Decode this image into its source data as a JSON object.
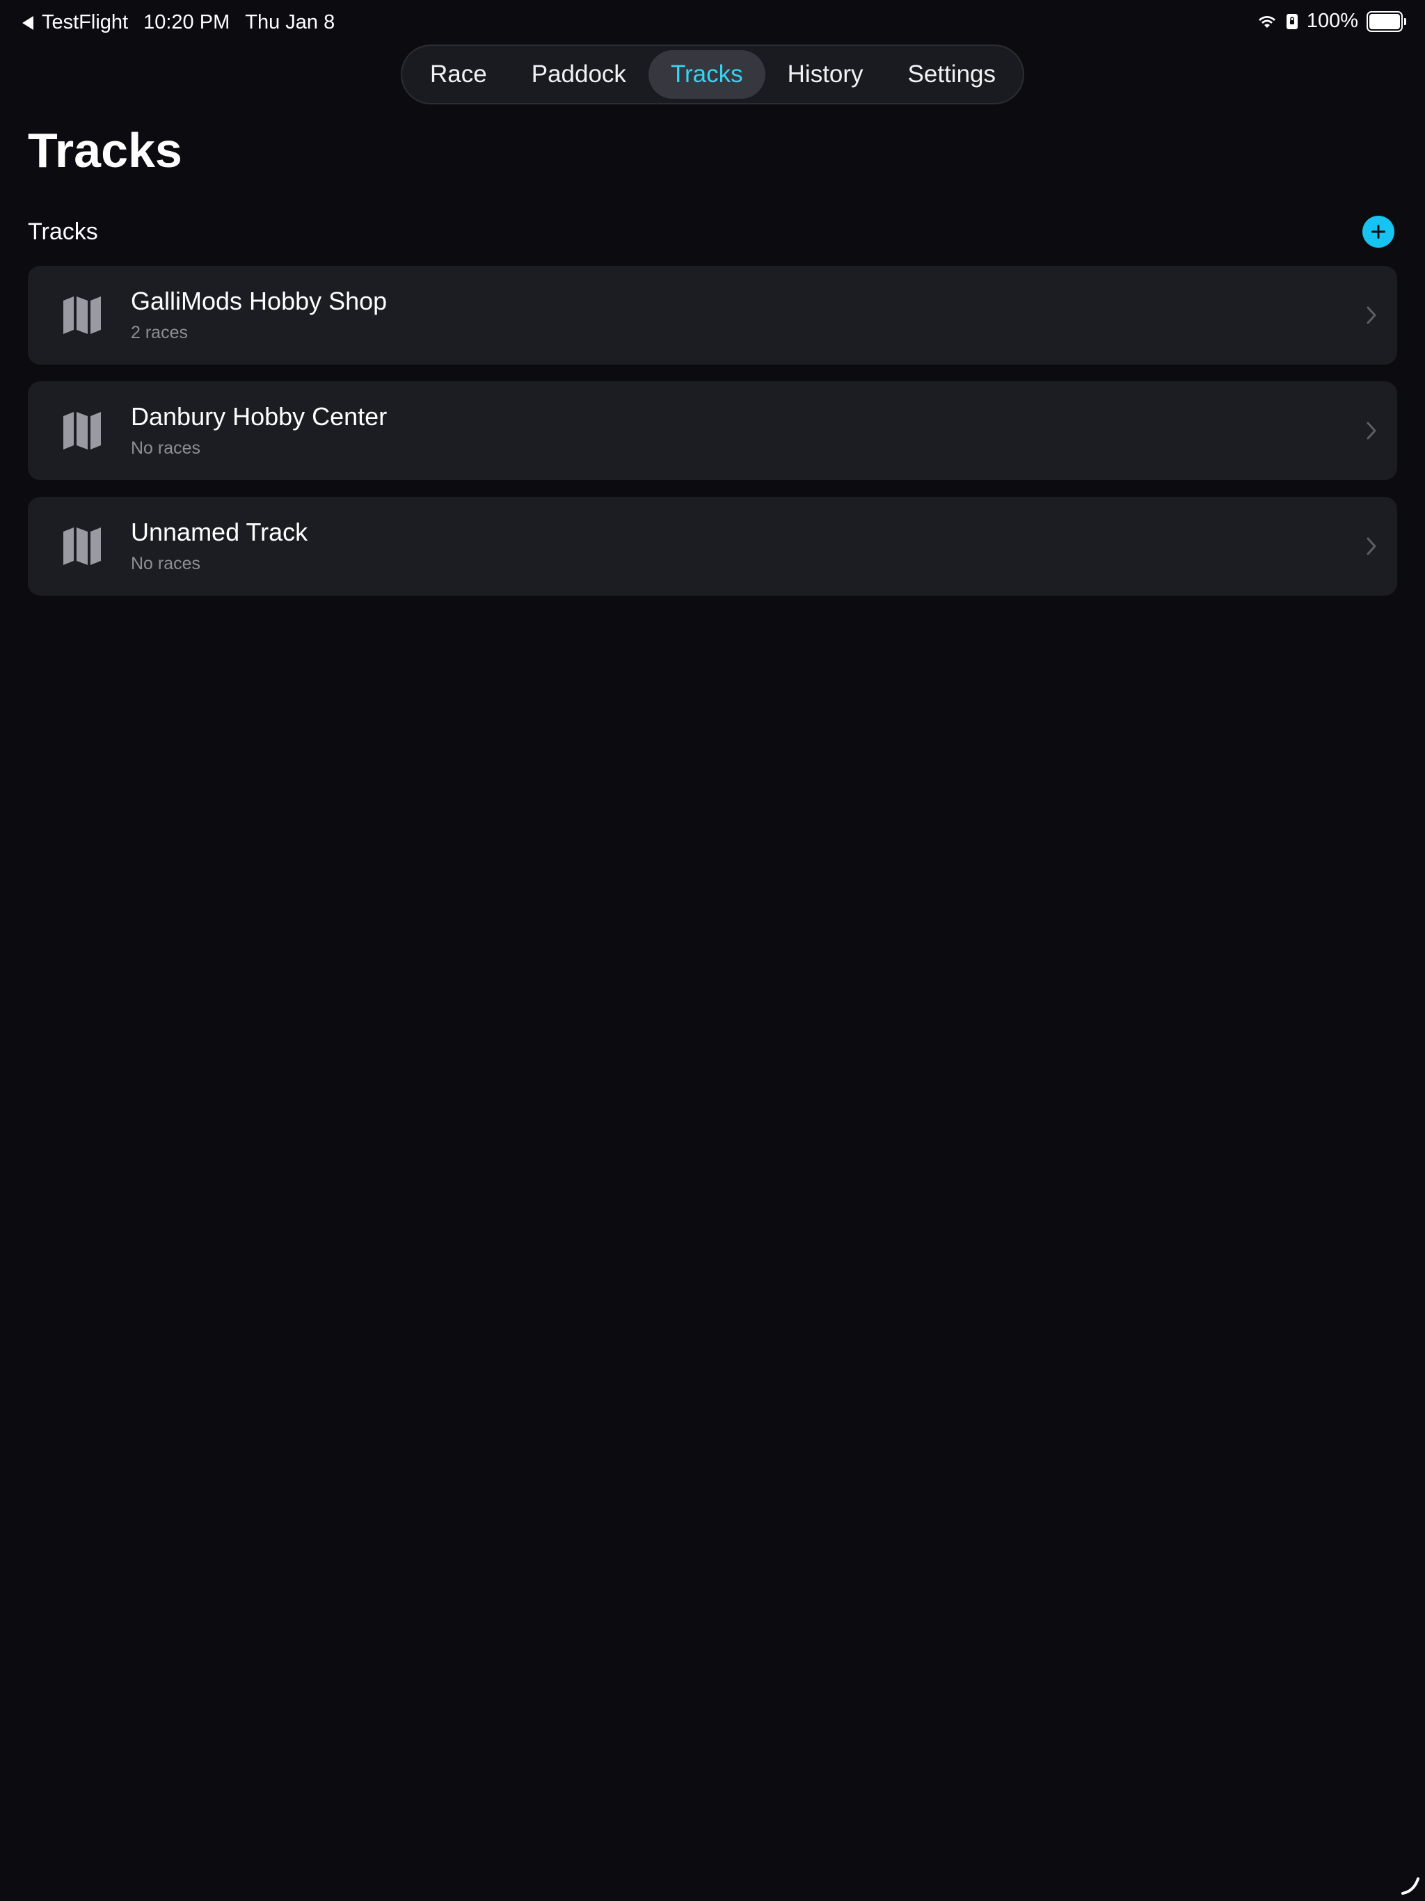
{
  "status_bar": {
    "back_app": "TestFlight",
    "time": "10:20 PM",
    "date": "Thu Jan 8",
    "battery_text": "100%",
    "battery_level": 1.0
  },
  "nav": {
    "tabs": [
      {
        "label": "Race"
      },
      {
        "label": "Paddock"
      },
      {
        "label": "Tracks"
      },
      {
        "label": "History"
      },
      {
        "label": "Settings"
      }
    ],
    "active": "Tracks"
  },
  "page": {
    "title": "Tracks",
    "section_title": "Tracks"
  },
  "tracks": [
    {
      "name": "GalliMods Hobby Shop",
      "races": "2 races",
      "icon": "map-icon"
    },
    {
      "name": "Danbury Hobby Center",
      "races": "No races",
      "icon": "map-icon"
    },
    {
      "name": "Unnamed Track",
      "races": "No races",
      "icon": "map-icon"
    }
  ],
  "colors": {
    "background": "#0b0b10",
    "card": "#1c1d22",
    "accent": "#34d4f2",
    "add_button": "#17c3f0",
    "secondary_text": "#8e8f96"
  }
}
